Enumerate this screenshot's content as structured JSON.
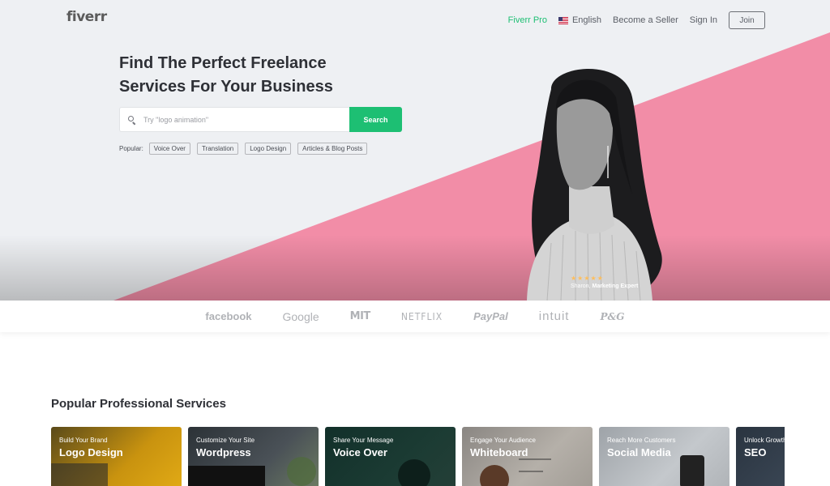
{
  "nav": {
    "logo": "fiverr",
    "fiverr_pro": "Fiverr Pro",
    "language": "English",
    "become_seller": "Become a Seller",
    "sign_in": "Sign In",
    "join": "Join"
  },
  "hero": {
    "headline": "Find The Perfect Freelance Services For Your Business",
    "search": {
      "placeholder": "Try \"logo animation\"",
      "button": "Search"
    },
    "popular_label": "Popular:",
    "popular_tags": [
      "Voice Over",
      "Translation",
      "Logo Design",
      "Articles & Blog Posts"
    ],
    "testimonial": {
      "stars": "★★★★★",
      "name": "Sharon,",
      "role": "Marketing Expert"
    },
    "colors": {
      "pink": "#f28da7",
      "accent": "#1dbf73"
    }
  },
  "trusted_by": [
    "facebook",
    "Google",
    "MIT",
    "NETFLIX",
    "PayPal",
    "intuit",
    "P&G"
  ],
  "services": {
    "title": "Popular Professional Services",
    "cards": [
      {
        "sub": "Build Your Brand",
        "title": "Logo Design"
      },
      {
        "sub": "Customize Your Site",
        "title": "Wordpress"
      },
      {
        "sub": "Share Your Message",
        "title": "Voice Over"
      },
      {
        "sub": "Engage Your Audience",
        "title": "Whiteboard"
      },
      {
        "sub": "Reach More Customers",
        "title": "Social Media"
      },
      {
        "sub": "Unlock Growth Online",
        "title": "SEO"
      }
    ]
  }
}
